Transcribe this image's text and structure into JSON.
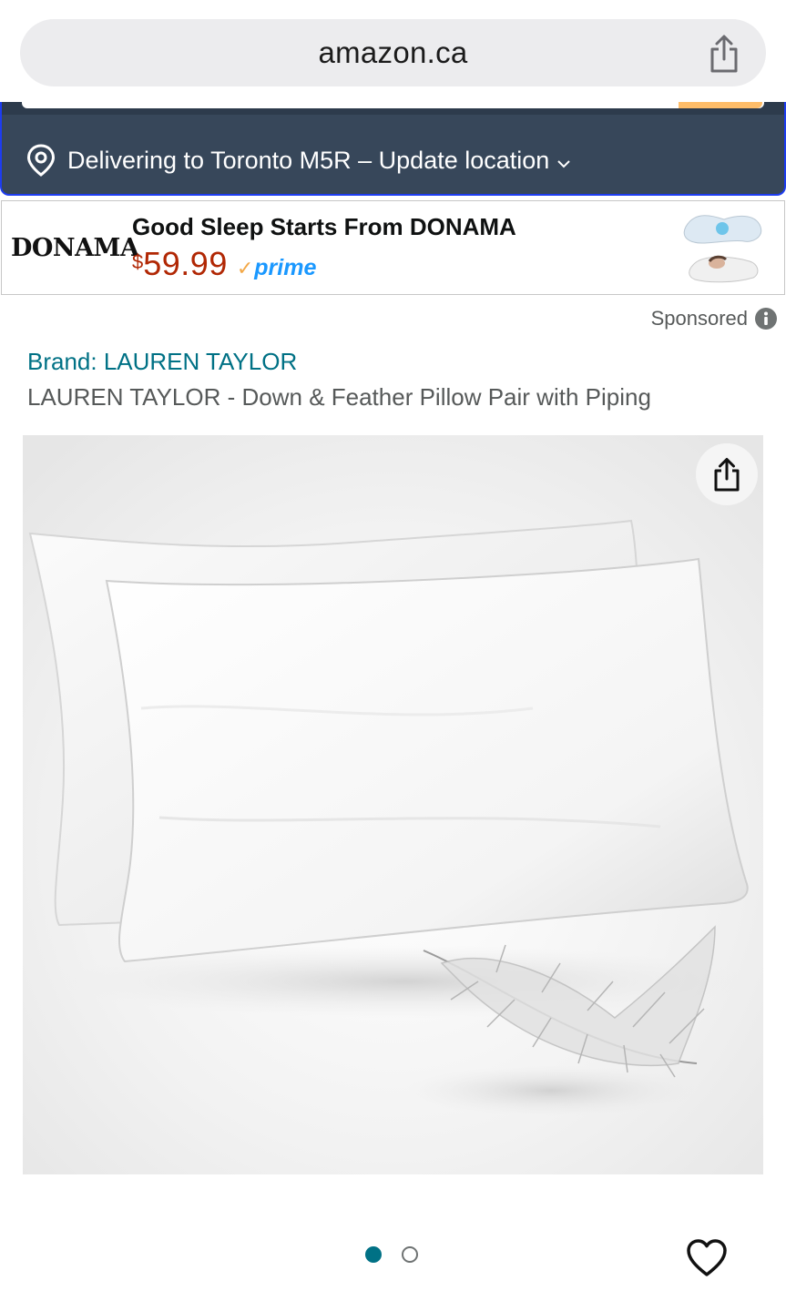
{
  "browser": {
    "url": "amazon.ca",
    "share_icon": "share-icon"
  },
  "header": {
    "delivery_text": "Delivering to Toronto M5R – Update location",
    "location_icon": "location-pin-icon",
    "chevron_icon": "chevron-down-icon"
  },
  "ad_banner": {
    "brand_logo": "DONAMA",
    "headline": "Good Sleep Starts From DONAMA",
    "price_symbol": "$",
    "price_value": "59.99",
    "prime_label": "prime"
  },
  "sponsored": {
    "label": "Sponsored",
    "info_icon": "info-icon"
  },
  "product": {
    "brand_link": "Brand: LAUREN TAYLOR",
    "title": "LAUREN TAYLOR - Down & Feather Pillow Pair with Piping",
    "image_share_icon": "share-icon",
    "carousel_count": 2,
    "carousel_active": 1,
    "wishlist_icon": "heart-icon"
  },
  "colors": {
    "link": "#007185",
    "price": "#b12704",
    "header_bg": "#37475a",
    "prime_blue": "#1a98ff"
  }
}
